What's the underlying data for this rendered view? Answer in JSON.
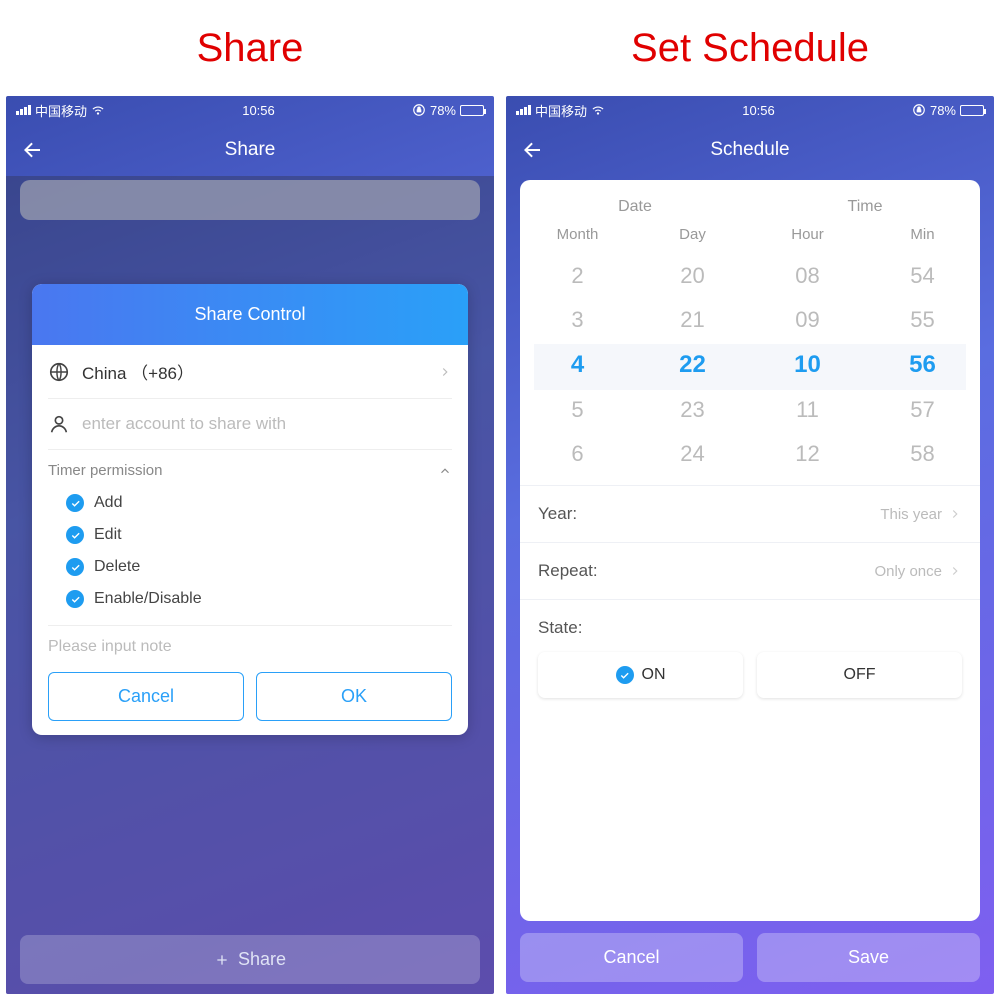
{
  "labels": {
    "share": "Share",
    "schedule": "Set Schedule"
  },
  "status": {
    "carrier": "中国移动",
    "time": "10:56",
    "battery_pct": "78%",
    "battery_fill": 78
  },
  "share": {
    "nav_title": "Share",
    "modal_title": "Share Control",
    "country": "China （+86）",
    "account_placeholder": "enter account to share with",
    "perm_header": "Timer permission",
    "perms": [
      "Add",
      "Edit",
      "Delete",
      "Enable/Disable"
    ],
    "note_placeholder": "Please input note",
    "cancel": "Cancel",
    "ok": "OK",
    "bottom_share": "Share"
  },
  "schedule": {
    "nav_title": "Schedule",
    "tabs": {
      "date": "Date",
      "time": "Time"
    },
    "cols": {
      "month": {
        "label": "Month",
        "v": [
          "2",
          "3",
          "4",
          "5",
          "6"
        ],
        "sel": 2
      },
      "day": {
        "label": "Day",
        "v": [
          "20",
          "21",
          "22",
          "23",
          "24"
        ],
        "sel": 2
      },
      "hour": {
        "label": "Hour",
        "v": [
          "08",
          "09",
          "10",
          "11",
          "12"
        ],
        "sel": 2
      },
      "min": {
        "label": "Min",
        "v": [
          "54",
          "55",
          "56",
          "57",
          "58"
        ],
        "sel": 2
      }
    },
    "year_label": "Year:",
    "year_val": "This year",
    "repeat_label": "Repeat:",
    "repeat_val": "Only once",
    "state_label": "State:",
    "on": "ON",
    "off": "OFF",
    "cancel": "Cancel",
    "save": "Save"
  }
}
